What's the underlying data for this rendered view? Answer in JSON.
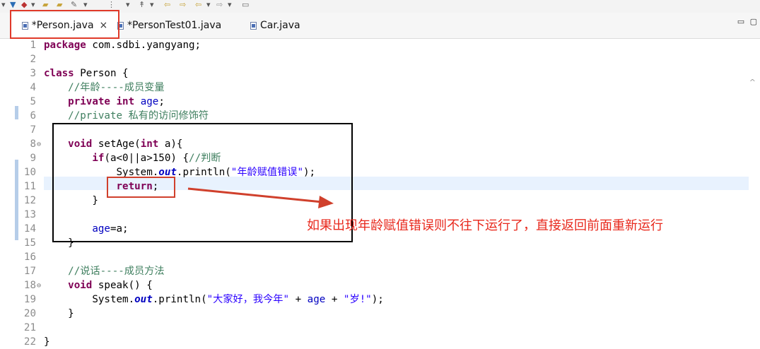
{
  "tabs": [
    {
      "label": "*Person.java",
      "active": true,
      "closable": true
    },
    {
      "label": "*PersonTest01.java",
      "active": false
    },
    {
      "label": "Car.java",
      "active": false
    }
  ],
  "code_lines": [
    {
      "n": "1",
      "html": "<span class=\"kw\">package</span> com.sdbi.yangyang;"
    },
    {
      "n": "2",
      "html": ""
    },
    {
      "n": "3",
      "html": "<span class=\"kw\">class</span> Person {"
    },
    {
      "n": "4",
      "html": "    <span class=\"cm\">//年龄----成员变量</span>"
    },
    {
      "n": "5",
      "html": "    <span class=\"kw\">private</span> <span class=\"kw\">int</span> <span class=\"fld\">age</span>;"
    },
    {
      "n": "6",
      "html": "    <span class=\"cm\">//private 私有的访问修饰符</span>"
    },
    {
      "n": "7",
      "html": ""
    },
    {
      "n": "8",
      "fold": true,
      "html": "    <span class=\"kw\">void</span> setAge(<span class=\"kw\">int</span> a){"
    },
    {
      "n": "9",
      "html": "        <span class=\"kw\">if</span>(a&lt;0||a&gt;150) {<span class=\"cm\">//判断</span>"
    },
    {
      "n": "10",
      "html": "            System.<span class=\"st\">out</span>.println(<span class=\"str\">\"年龄赋值错误\"</span>);"
    },
    {
      "n": "11",
      "html": "            <span class=\"kw\">return</span>;"
    },
    {
      "n": "12",
      "html": "        }"
    },
    {
      "n": "13",
      "html": ""
    },
    {
      "n": "14",
      "html": "        <span class=\"fld\">age</span>=a;"
    },
    {
      "n": "15",
      "html": "    }"
    },
    {
      "n": "16",
      "html": ""
    },
    {
      "n": "17",
      "html": "    <span class=\"cm\">//说话----成员方法</span>"
    },
    {
      "n": "18",
      "fold": true,
      "html": "    <span class=\"kw\">void</span> speak() {"
    },
    {
      "n": "19",
      "html": "        System.<span class=\"st\">out</span>.println(<span class=\"str\">\"大家好，我今年\"</span> + <span class=\"fld\">age</span> + <span class=\"str\">\"岁!\"</span>);"
    },
    {
      "n": "20",
      "html": "    }"
    },
    {
      "n": "21",
      "html": ""
    },
    {
      "n": "22",
      "html": "}"
    }
  ],
  "annotation": {
    "text": "如果出现年龄赋值错误则不往下运行了，直接返回前面重新运行"
  },
  "colors": {
    "keyword": "#7f0055",
    "comment": "#3f7f5f",
    "string": "#2a00ff",
    "field": "#0000c0",
    "annotation_red": "#e8281c",
    "current_line": "#e8f2fe"
  }
}
